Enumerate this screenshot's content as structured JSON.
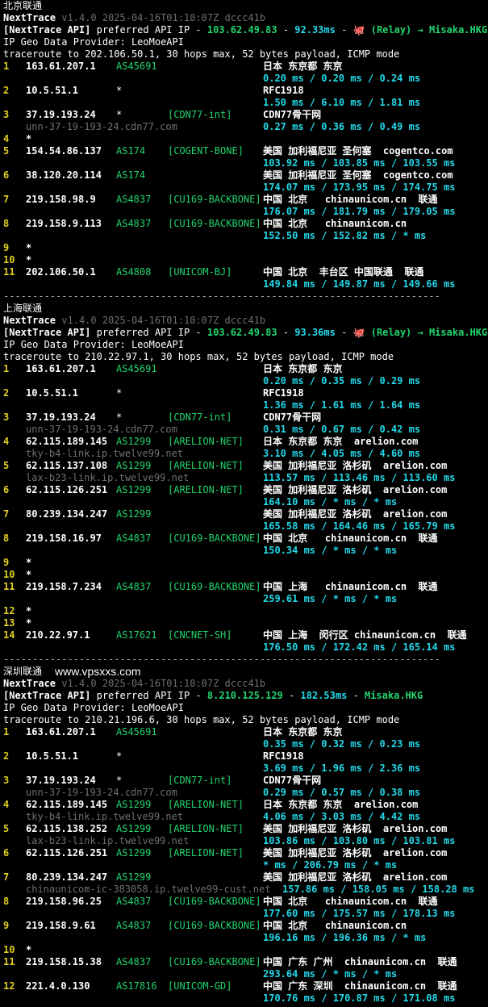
{
  "colors": {
    "background": "#000000",
    "hop_number": "#e0d020",
    "asn": "#21d46d",
    "tag": "#21d46d",
    "latency": "#22d8e8",
    "hostname": "#6f6f6f",
    "text": "#d6d6d6"
  },
  "separator": "---------------------------------------------------------------------------",
  "sections": [
    {
      "title": "北京联通",
      "tool_name": "NextTrace",
      "tool_version": "v1.4.0 2025-04-16T01:10:07Z dccc41b",
      "api_prefix": "[NextTrace API]",
      "api_text": "preferred API IP - ",
      "api_ip": "103.62.49.83",
      "api_latency": "92.33ms",
      "api_route": "🐙 (Relay) → Misaka.HKG",
      "provider": "IP Geo Data Provider: LeoMoeAPI",
      "trace_cmd": "traceroute to 202.106.50.1, 30 hops max, 52 bytes payload, ICMP mode",
      "hops": [
        {
          "n": "1",
          "ip": "163.61.207.1",
          "asn": "AS45691",
          "tag": "",
          "geo": "日本 东京都 东京",
          "host": "",
          "latency": "0.20 ms / 0.20 ms / 0.24 ms"
        },
        {
          "n": "2",
          "ip": "10.5.51.1",
          "asn": "*",
          "tag": "",
          "geo": "RFC1918",
          "host": "",
          "latency": "1.50 ms / 6.10 ms / 1.81 ms"
        },
        {
          "n": "3",
          "ip": "37.19.193.24",
          "asn": "*",
          "tag": "[CDN77-int]",
          "geo": "CDN77骨干网",
          "host": "unn-37-19-193-24.cdn77.com",
          "latency": "0.27 ms / 0.36 ms / 0.49 ms"
        },
        {
          "n": "4",
          "ip": "*"
        },
        {
          "n": "5",
          "ip": "154.54.86.137",
          "asn": "AS174",
          "tag": "[COGENT-BONE]",
          "geo": "美国 加利福尼亚 圣何塞  cogentco.com",
          "host": "",
          "latency": "103.92 ms / 103.85 ms / 103.55 ms"
        },
        {
          "n": "6",
          "ip": "38.120.20.114",
          "asn": "AS174",
          "tag": "",
          "geo": "美国 加利福尼亚 圣何塞  cogentco.com",
          "host": "",
          "latency": "174.07 ms / 173.95 ms / 174.75 ms"
        },
        {
          "n": "7",
          "ip": "219.158.98.9",
          "asn": "AS4837",
          "tag": "[CU169-BACKBONE]",
          "geo": "中国 北京   chinaunicom.cn  联通",
          "host": "",
          "latency": "176.07 ms / 181.79 ms / 179.05 ms"
        },
        {
          "n": "8",
          "ip": "219.158.9.113",
          "asn": "AS4837",
          "tag": "[CU169-BACKBONE]",
          "geo": "中国 北京   chinaunicom.cn",
          "host": "",
          "latency": "152.50 ms / 152.82 ms / * ms"
        },
        {
          "n": "9",
          "ip": "*"
        },
        {
          "n": "10",
          "ip": "*"
        },
        {
          "n": "11",
          "ip": "202.106.50.1",
          "asn": "AS4808",
          "tag": "[UNICOM-BJ]",
          "geo": "中国 北京  丰台区 中国联通  联通",
          "host": "",
          "latency": "149.84 ms / 149.87 ms / 149.66 ms"
        }
      ]
    },
    {
      "title": "上海联通",
      "tool_name": "NextTrace",
      "tool_version": "v1.4.0 2025-04-16T01:10:07Z dccc41b",
      "api_prefix": "[NextTrace API]",
      "api_text": "preferred API IP - ",
      "api_ip": "103.62.49.83",
      "api_latency": "93.36ms",
      "api_route": "🐙 (Relay) → Misaka.HKG",
      "provider": "IP Geo Data Provider: LeoMoeAPI",
      "trace_cmd": "traceroute to 210.22.97.1, 30 hops max, 52 bytes payload, ICMP mode",
      "hops": [
        {
          "n": "1",
          "ip": "163.61.207.1",
          "asn": "AS45691",
          "tag": "",
          "geo": "日本 东京都 东京",
          "host": "",
          "latency": "0.20 ms / 0.35 ms / 0.29 ms"
        },
        {
          "n": "2",
          "ip": "10.5.51.1",
          "asn": "*",
          "tag": "",
          "geo": "RFC1918",
          "host": "",
          "latency": "1.36 ms / 1.61 ms / 1.64 ms"
        },
        {
          "n": "3",
          "ip": "37.19.193.24",
          "asn": "*",
          "tag": "[CDN77-int]",
          "geo": "CDN77骨干网",
          "host": "unn-37-19-193-24.cdn77.com",
          "latency": "0.31 ms / 0.67 ms / 0.42 ms"
        },
        {
          "n": "4",
          "ip": "62.115.189.145",
          "asn": "AS1299",
          "tag": "[ARELION-NET]",
          "geo": "日本 东京都 东京  arelion.com",
          "host": "tky-b4-link.ip.twelve99.net",
          "latency": "3.10 ms / 4.05 ms / 4.60 ms"
        },
        {
          "n": "5",
          "ip": "62.115.137.108",
          "asn": "AS1299",
          "tag": "[ARELION-NET]",
          "geo": "美国 加利福尼亚 洛杉矶  arelion.com",
          "host": "lax-b23-link.ip.twelve99.net",
          "latency": "113.57 ms / 113.46 ms / 113.60 ms"
        },
        {
          "n": "6",
          "ip": "62.115.126.251",
          "asn": "AS1299",
          "tag": "[ARELION-NET]",
          "geo": "美国 加利福尼亚 洛杉矶  arelion.com",
          "host": "",
          "latency": "164.10 ms / * ms / * ms"
        },
        {
          "n": "7",
          "ip": "80.239.134.247",
          "asn": "AS1299",
          "tag": "",
          "geo": "美国 加利福尼亚 洛杉矶  arelion.com",
          "host": "",
          "latency": "165.58 ms / 164.46 ms / 165.79 ms"
        },
        {
          "n": "8",
          "ip": "219.158.16.97",
          "asn": "AS4837",
          "tag": "[CU169-BACKBONE]",
          "geo": "中国 北京   chinaunicom.cn  联通",
          "host": "",
          "latency": "150.34 ms / * ms / * ms"
        },
        {
          "n": "9",
          "ip": "*"
        },
        {
          "n": "10",
          "ip": "*"
        },
        {
          "n": "11",
          "ip": "219.158.7.234",
          "asn": "AS4837",
          "tag": "[CU169-BACKBONE]",
          "geo": "中国 上海   chinaunicom.cn  联通",
          "host": "",
          "latency": "259.61 ms / * ms / * ms"
        },
        {
          "n": "12",
          "ip": "*"
        },
        {
          "n": "13",
          "ip": "*"
        },
        {
          "n": "14",
          "ip": "210.22.97.1",
          "asn": "AS17621",
          "tag": "[CNCNET-SH]",
          "geo": "中国 上海  闵行区 chinaunicom.cn  联通",
          "host": "",
          "latency": "176.50 ms / 172.42 ms / 165.14 ms"
        }
      ]
    },
    {
      "title": "深圳联通",
      "watermark": "www.vpsxxs.com",
      "tool_name": "NextTrace",
      "tool_version": "v1.4.0 2025-04-16T01:10:07Z dccc41b",
      "api_prefix": "[NextTrace API]",
      "api_text": "preferred API IP - ",
      "api_ip": "8.210.125.129",
      "api_latency": "182.53ms",
      "api_route": "Misaka.HKG",
      "provider": "IP Geo Data Provider: LeoMoeAPI",
      "trace_cmd": "traceroute to 210.21.196.6, 30 hops max, 52 bytes payload, ICMP mode",
      "hops": [
        {
          "n": "1",
          "ip": "163.61.207.1",
          "asn": "AS45691",
          "tag": "",
          "geo": "日本 东京都 东京",
          "host": "",
          "latency": "0.35 ms / 0.32 ms / 0.23 ms"
        },
        {
          "n": "2",
          "ip": "10.5.51.1",
          "asn": "*",
          "tag": "",
          "geo": "RFC1918",
          "host": "",
          "latency": "3.69 ms / 1.96 ms / 2.36 ms"
        },
        {
          "n": "3",
          "ip": "37.19.193.24",
          "asn": "*",
          "tag": "[CDN77-int]",
          "geo": "CDN77骨干网",
          "host": "unn-37-19-193-24.cdn77.com",
          "latency": "0.29 ms / 0.57 ms / 0.38 ms"
        },
        {
          "n": "4",
          "ip": "62.115.189.145",
          "asn": "AS1299",
          "tag": "[ARELION-NET]",
          "geo": "日本 东京都 东京  arelion.com",
          "host": "tky-b4-link.ip.twelve99.net",
          "latency": "4.06 ms / 3.03 ms / 4.42 ms"
        },
        {
          "n": "5",
          "ip": "62.115.138.252",
          "asn": "AS1299",
          "tag": "[ARELION-NET]",
          "geo": "美国 加利福尼亚 洛杉矶  arelion.com",
          "host": "lax-b23-link.ip.twelve99.net",
          "latency": "103.86 ms / 103.80 ms / 103.81 ms"
        },
        {
          "n": "6",
          "ip": "62.115.126.251",
          "asn": "AS1299",
          "tag": "[ARELION-NET]",
          "geo": "美国 加利福尼亚 洛杉矶  arelion.com",
          "host": "",
          "latency": "* ms / 206.79 ms / * ms"
        },
        {
          "n": "7",
          "ip": "80.239.134.247",
          "asn": "AS1299",
          "tag": "",
          "geo": "美国 加利福尼亚 洛杉矶  arelion.com",
          "host": "chinaunicom-ic-383058.ip.twelve99-cust.net",
          "latency": "157.86 ms / 158.05 ms / 158.28 ms",
          "inline": true
        },
        {
          "n": "8",
          "ip": "219.158.96.25",
          "asn": "AS4837",
          "tag": "[CU169-BACKBONE]",
          "geo": "中国 北京   chinaunicom.cn  联通",
          "host": "",
          "latency": "177.60 ms / 175.57 ms / 178.13 ms"
        },
        {
          "n": "9",
          "ip": "219.158.9.61",
          "asn": "AS4837",
          "tag": "[CU169-BACKBONE]",
          "geo": "中国 北京   chinaunicom.cn",
          "host": "",
          "latency": "196.16 ms / 196.36 ms / * ms"
        },
        {
          "n": "10",
          "ip": "*"
        },
        {
          "n": "11",
          "ip": "219.158.15.38",
          "asn": "AS4837",
          "tag": "[CU169-BACKBONE]",
          "geo": "中国 广东 广州  chinaunicom.cn  联通",
          "host": "",
          "latency": "293.64 ms / * ms / * ms"
        },
        {
          "n": "12",
          "ip": "221.4.0.130",
          "asn": "AS17816",
          "tag": "[UNICOM-GD]",
          "geo": "中国 广东 深圳  chinaunicom.cn  联通",
          "host": "",
          "latency": "170.76 ms / 170.87 ms / 171.08 ms"
        }
      ]
    }
  ]
}
